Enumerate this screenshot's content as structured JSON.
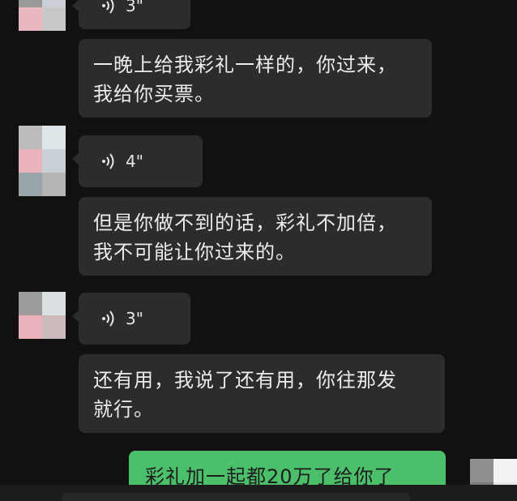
{
  "messages": [
    {
      "type": "voice",
      "duration": "3\""
    },
    {
      "type": "text",
      "lines": [
        "一晚上给我彩礼一样的，你过来，",
        "我给你买票。"
      ]
    },
    {
      "type": "voice",
      "duration": "4\""
    },
    {
      "type": "text",
      "lines": [
        "但是你做不到的话，彩礼不加倍，",
        "我不可能让你过来的。"
      ]
    },
    {
      "type": "voice",
      "duration": "3\""
    },
    {
      "type": "text",
      "lines": [
        "还有用，我说了还有用，你往那发",
        "就行。"
      ]
    },
    {
      "type": "text",
      "sender": "me",
      "lines": [
        "彩礼加一起都20万了给你了"
      ]
    }
  ],
  "colors": {
    "background": "#111111",
    "incoming_bubble": "#2c2c2c",
    "outgoing_bubble": "#4cbf6b"
  },
  "icons": {
    "voice": "voice-wave-icon",
    "avatar": "pixelated-avatar-icon"
  }
}
